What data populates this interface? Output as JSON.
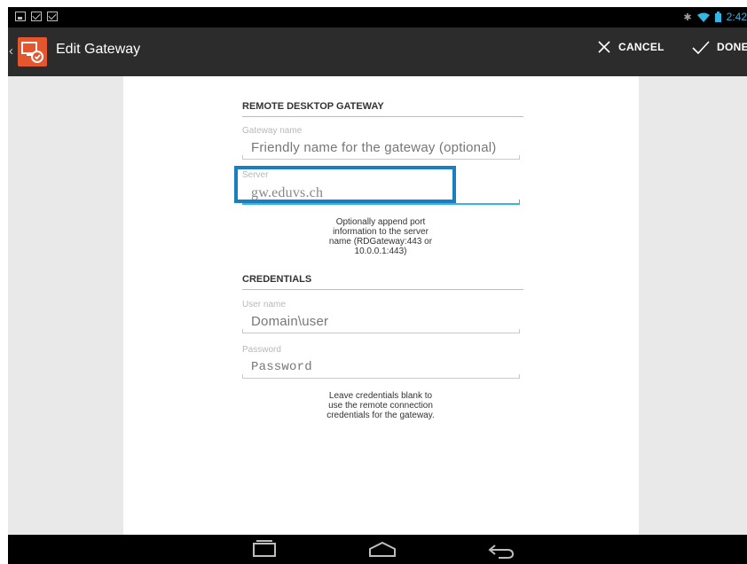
{
  "statusbar": {
    "time": "2:42"
  },
  "actionbar": {
    "title": "Edit Gateway",
    "cancel_label": "CANCEL",
    "done_label": "DONE"
  },
  "gateway_section": {
    "title": "REMOTE DESKTOP GATEWAY",
    "gateway_name": {
      "label": "Gateway name",
      "placeholder": "Friendly name for the gateway (optional)"
    },
    "server": {
      "label": "Server",
      "value": "gw.eduvs.ch"
    },
    "server_hint": [
      "Optionally append port",
      "information to the server",
      "name (RDGateway:443 or",
      "10.0.0.1:443)"
    ]
  },
  "credentials_section": {
    "title": "CREDENTIALS",
    "user_name": {
      "label": "User name",
      "placeholder": "Domain\\user"
    },
    "password": {
      "label": "Password",
      "placeholder": "Password"
    },
    "credentials_hint": [
      "Leave credentials blank to",
      "use the remote connection",
      "credentials for the gateway."
    ]
  },
  "colors": {
    "accent": "#33b5e5",
    "highlight_box": "#1a7fc1",
    "app_icon": "#e4572e"
  },
  "icons": [
    "gallery-icon",
    "mail-icon",
    "mail-icon",
    "bluetooth-icon",
    "wifi-icon",
    "battery-icon",
    "remote-desktop-app-icon",
    "close-icon",
    "check-icon",
    "recent-apps-icon",
    "home-icon",
    "back-icon"
  ]
}
